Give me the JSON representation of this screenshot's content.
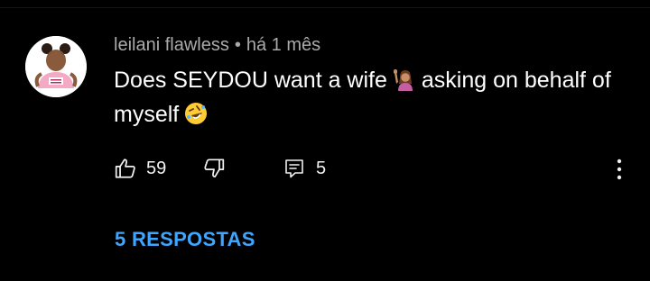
{
  "comment": {
    "author": "leilani flawless",
    "separator": "•",
    "time_ago": "há 1 mês",
    "text_part1": "Does SEYDOU want a wife",
    "text_part2": "asking on behalf of myself",
    "emoji_1": "raising-hand-emoji",
    "emoji_2": "rofl-emoji",
    "likes": "59",
    "replies_count": "5",
    "replies_link": "5 RESPOSTAS"
  },
  "colors": {
    "background": "#000000",
    "author_meta": "#aaaaaa",
    "text": "#ffffff",
    "link": "#3ea6ff"
  },
  "icons": {
    "like": "thumbs-up-icon",
    "dislike": "thumbs-down-icon",
    "reply": "reply-icon",
    "more": "more-vertical-icon"
  }
}
